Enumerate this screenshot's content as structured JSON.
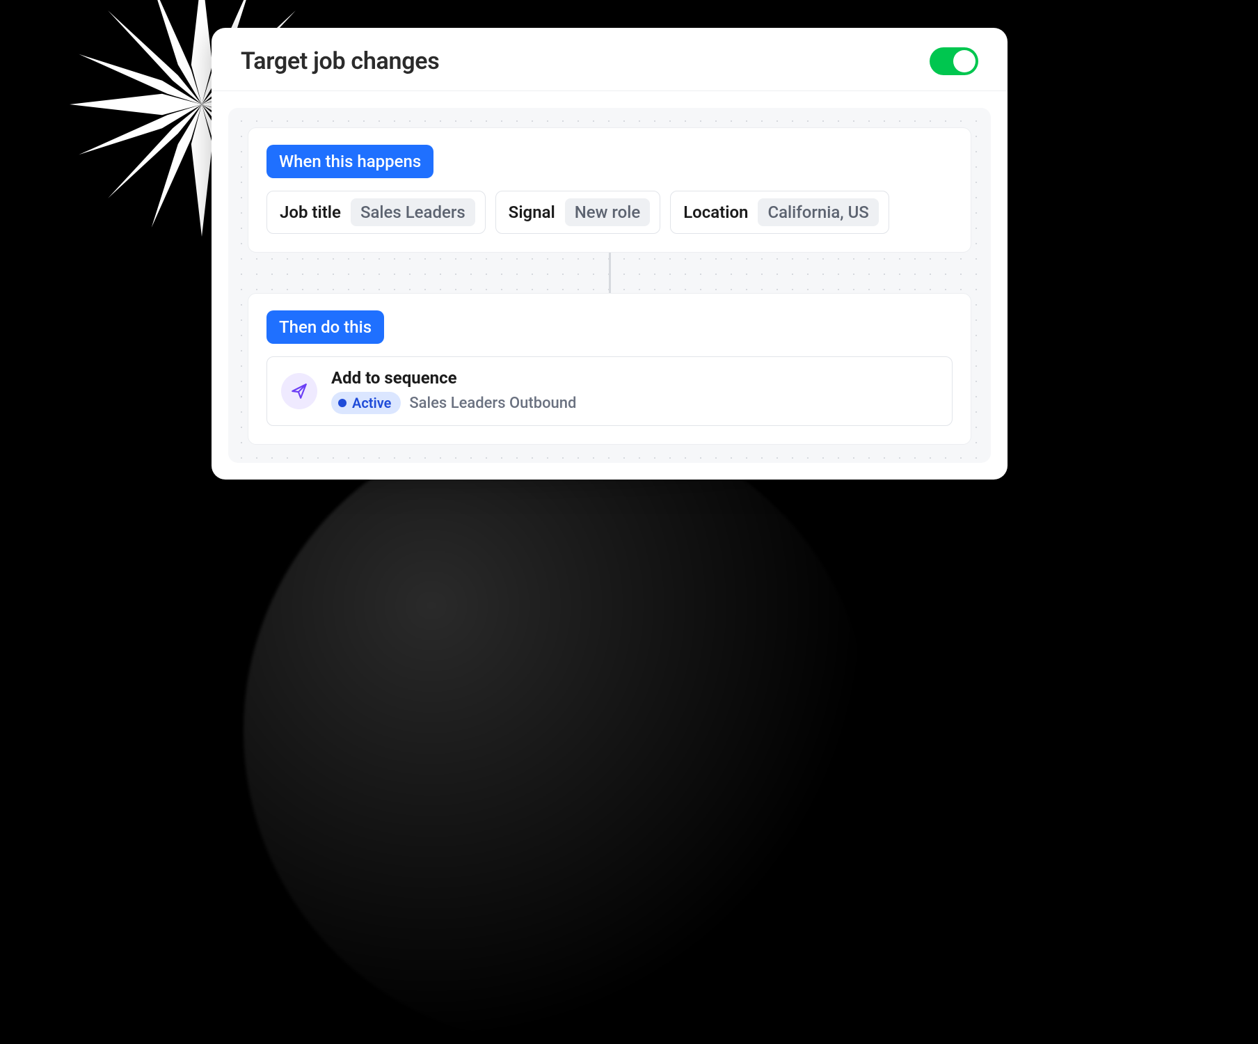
{
  "header": {
    "title": "Target job changes",
    "toggle_on": true
  },
  "trigger": {
    "badge": "When this happens",
    "filters": [
      {
        "label": "Job title",
        "value": "Sales Leaders"
      },
      {
        "label": "Signal",
        "value": "New role"
      },
      {
        "label": "Location",
        "value": "California, US"
      }
    ]
  },
  "action": {
    "badge": "Then do this",
    "title": "Add to sequence",
    "status": "Active",
    "sequence_name": "Sales Leaders Outbound"
  }
}
